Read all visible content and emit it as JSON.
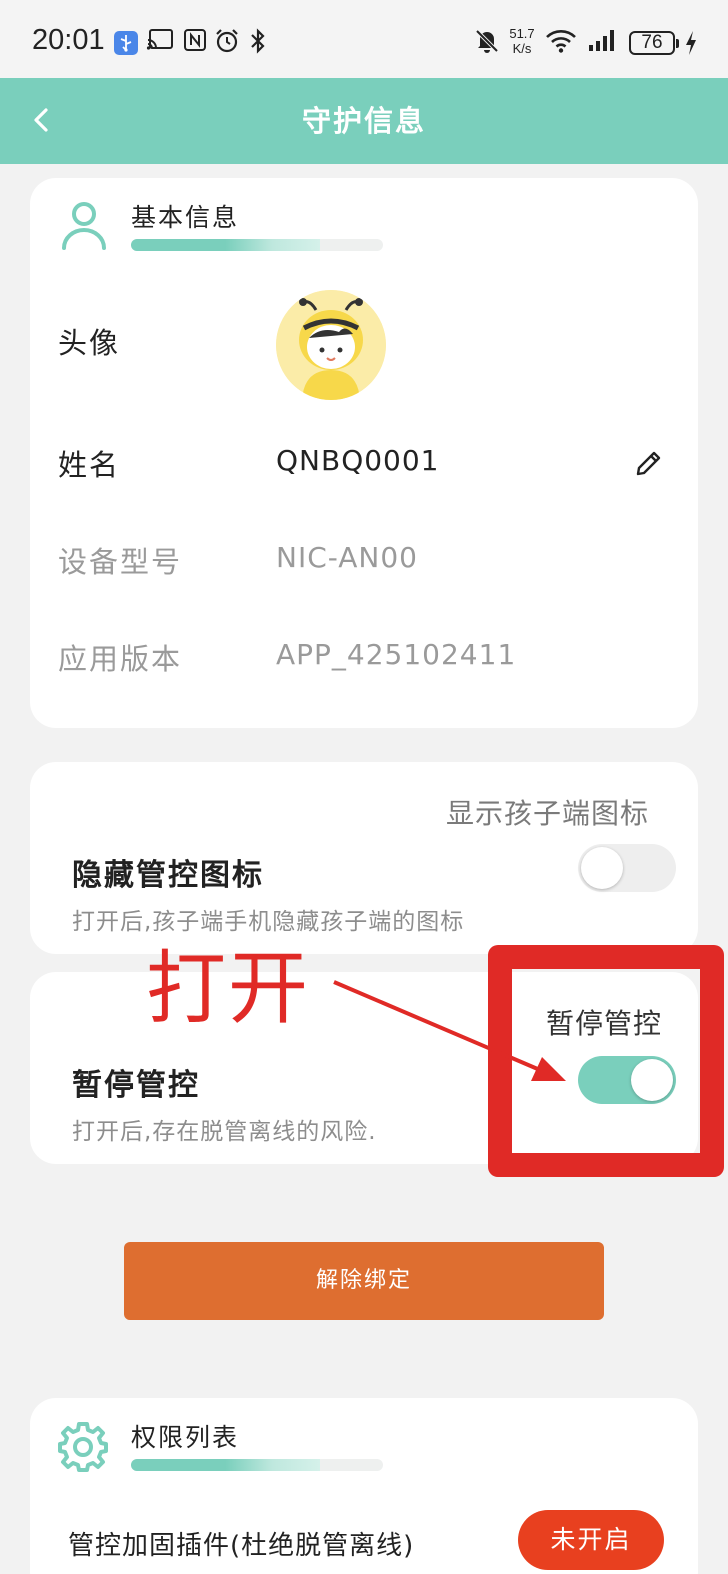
{
  "status_bar": {
    "time": "20:01",
    "net_speed_value": "51.7",
    "net_speed_unit": "K/s",
    "battery": "76",
    "icons": [
      "usb-connection-icon",
      "cast-icon",
      "nfc-icon",
      "alarm-icon",
      "bluetooth-icon",
      "mute-icon",
      "wifi-icon",
      "signal-icon",
      "battery-icon",
      "charging-icon"
    ]
  },
  "header": {
    "title": "守护信息",
    "back_icon": "chevron-left-icon"
  },
  "basic_info": {
    "section_title": "基本信息",
    "progress_level": 0.75,
    "rows": {
      "avatar_label": "头像",
      "name_label": "姓名",
      "name_value": "QNBQ0001",
      "model_label": "设备型号",
      "model_value": "NIC-AN00",
      "version_label": "应用版本",
      "version_value": "APP_425102411"
    }
  },
  "hide_icon": {
    "top_label": "显示孩子端图标",
    "title": "隐藏管控图标",
    "description": "打开后,孩子端手机隐藏孩子端的图标",
    "enabled": false
  },
  "pause_control": {
    "top_label": "暂停管控",
    "title": "暂停管控",
    "description": "打开后,存在脱管离线的风险.",
    "enabled": true
  },
  "annotation": {
    "text": "打开",
    "color": "#e02a26"
  },
  "actions": {
    "unbind_label": "解除绑定"
  },
  "permissions": {
    "section_title": "权限列表",
    "progress_level": 0.75,
    "item_label": "管控加固插件(杜绝脱管离线)",
    "item_status": "未开启"
  },
  "colors": {
    "accent": "#7acfbc",
    "unbind_button": "#de6e30",
    "status_badge": "#e8401f",
    "background": "#f2f2f2"
  }
}
